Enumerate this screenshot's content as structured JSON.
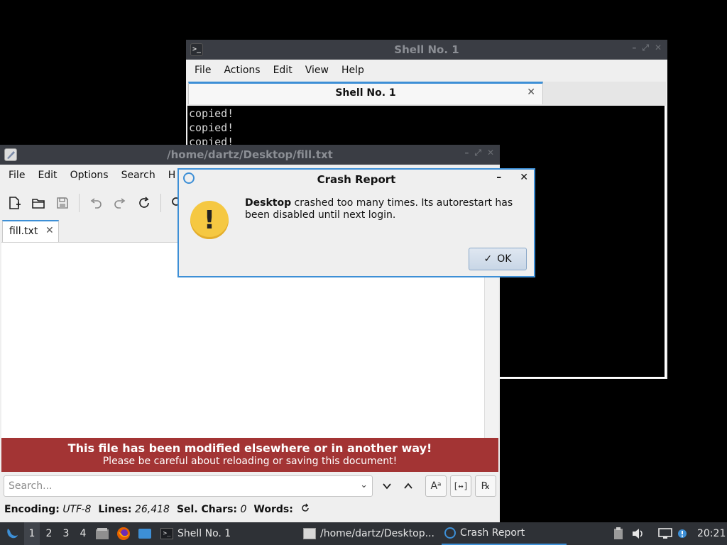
{
  "shell": {
    "title": "Shell No. 1",
    "menu": [
      "File",
      "Actions",
      "Edit",
      "View",
      "Help"
    ],
    "tab_label": "Shell No. 1",
    "terminal_lines": [
      "copied!",
      "copied!",
      "copied!"
    ]
  },
  "editor": {
    "title": "/home/dartz/Desktop/fill.txt",
    "menu": [
      "File",
      "Edit",
      "Options",
      "Search",
      "H"
    ],
    "tab_label": "fill.txt",
    "warning_line1": "This file has been modified elsewhere or in another way!",
    "warning_line2": "Please be careful about reloading or saving this document!",
    "search_placeholder": "Search...",
    "status": {
      "encoding_label": "Encoding:",
      "encoding_value": "UTF-8",
      "lines_label": "Lines:",
      "lines_value": "26,418",
      "selchars_label": "Sel. Chars:",
      "selchars_value": "0",
      "words_label": "Words:"
    }
  },
  "crash": {
    "title": "Crash Report",
    "msg_bold": "Desktop",
    "msg_rest": " crashed too many times. Its autorestart has been disabled until next login.",
    "ok_label": "OK"
  },
  "taskbar": {
    "workspaces": [
      "1",
      "2",
      "3",
      "4"
    ],
    "active_workspace": "1",
    "tasks": [
      "Shell No. 1",
      "/home/dartz/Desktop...",
      "Crash Report"
    ],
    "clock": "20:21"
  },
  "colors": {
    "accent": "#3d8fd6",
    "warning_bar": "#a33434",
    "titlebar": "#3a3d44",
    "taskbar": "#2e3136"
  }
}
